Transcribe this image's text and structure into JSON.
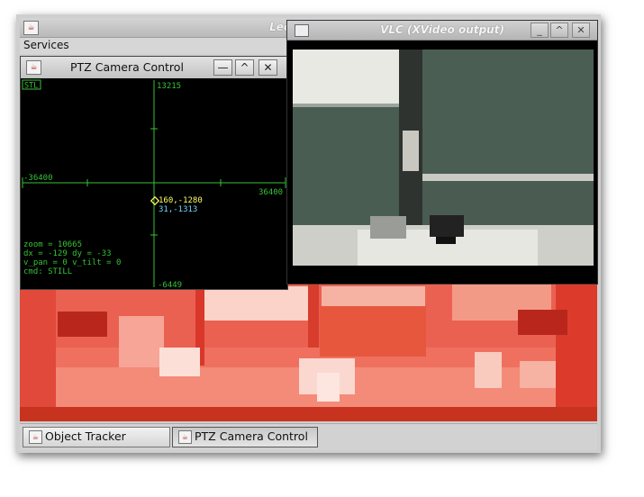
{
  "main_window": {
    "title": "LectureSight",
    "menu": {
      "services": "Services"
    }
  },
  "ptz_window": {
    "title": "PTZ Camera Control",
    "buttons": {
      "minimize": "—",
      "maximize": "^",
      "close": "✕"
    },
    "overlay": {
      "mode_badge": "STL",
      "tilt_max": "13215",
      "tilt_min": "-6449",
      "pan_min": "-36400",
      "pan_max": "36400",
      "target_pos": "160,-1280",
      "current_pos": "31,-1313",
      "zoom_line": "zoom = 10665",
      "delta_line": "dx = -129  dy = -33",
      "velocity_line": "v_pan = 0  v_tilt = 0",
      "cmd_line": "cmd: STILL"
    },
    "colors": {
      "grid": "#36c236",
      "target": "#ffff66",
      "current": "#6fd6ff",
      "text": "#36c236"
    }
  },
  "vlc_window": {
    "title": "VLC (XVideo output)",
    "buttons": {
      "minimize": "_",
      "maximize": "^",
      "close": "✕"
    }
  },
  "taskbar": {
    "items": [
      {
        "label": "Object Tracker",
        "active": false
      },
      {
        "label": "PTZ Camera Control",
        "active": true
      }
    ]
  }
}
